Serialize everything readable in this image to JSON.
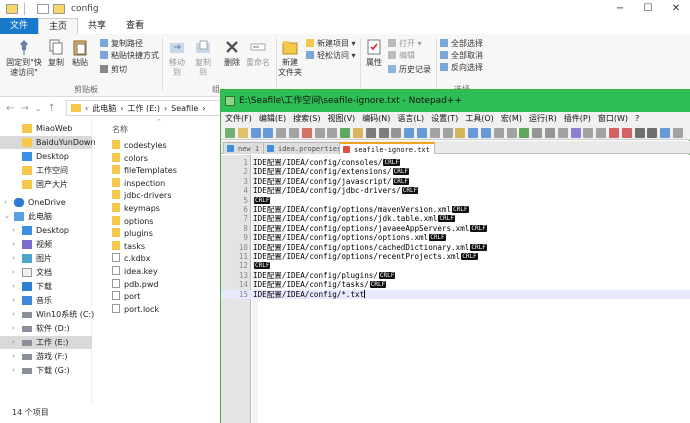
{
  "explorer": {
    "window_title": "config",
    "ribbon_tabs": [
      "文件",
      "主页",
      "共享",
      "查看"
    ],
    "ribbon": {
      "pin_label": "固定到\"快速访问\"",
      "copy_label": "复制",
      "paste_label": "粘贴",
      "copy_path": "复制路径",
      "paste_shortcut": "粘贴快捷方式",
      "cut": "剪切",
      "clipboard_group": "剪贴板",
      "move_to": "移动到",
      "copy_to": "复制到",
      "delete": "删除",
      "rename": "重命名",
      "organize_group": "组",
      "new_folder": "新建\n文件夹",
      "new_item": "新建项目",
      "easy_access": "轻松访问",
      "properties": "属性",
      "open": "打开",
      "edit": "编辑",
      "history": "历史记录",
      "select_all": "全部选择",
      "select_none": "全部取消",
      "invert_selection": "反向选择",
      "select_group": "选择"
    },
    "breadcrumb": [
      "此电脑",
      "工作 (E:)",
      "Seafile"
    ],
    "nav_items": [
      {
        "label": "MiaoWeb",
        "icon": "folder-icon",
        "indent": 1
      },
      {
        "label": "BaiduYunDown",
        "icon": "folder-icon",
        "indent": 1,
        "selected": true
      },
      {
        "label": "Desktop",
        "icon": "desktop-icon",
        "indent": 1
      },
      {
        "label": "工作空间",
        "icon": "folder-icon",
        "indent": 1
      },
      {
        "label": "国产大片",
        "icon": "folder-icon",
        "indent": 1
      },
      {
        "label": "OneDrive",
        "icon": "cloud-icon",
        "indent": 0,
        "arrow": "›"
      },
      {
        "label": "此电脑",
        "icon": "computer-icon",
        "indent": 0,
        "arrow": "⌄"
      },
      {
        "label": "Desktop",
        "icon": "desktop-icon",
        "indent": 1,
        "arrow": "›"
      },
      {
        "label": "视频",
        "icon": "video-icon",
        "indent": 1,
        "arrow": "›"
      },
      {
        "label": "图片",
        "icon": "picture-icon",
        "indent": 1,
        "arrow": "›"
      },
      {
        "label": "文档",
        "icon": "document-icon",
        "indent": 1,
        "arrow": "›"
      },
      {
        "label": "下载",
        "icon": "download-icon",
        "indent": 1,
        "arrow": "›"
      },
      {
        "label": "音乐",
        "icon": "music-icon",
        "indent": 1,
        "arrow": "›"
      },
      {
        "label": "Win10系统 (C:)",
        "icon": "drive-icon",
        "indent": 1,
        "arrow": "›"
      },
      {
        "label": "软件 (D:)",
        "icon": "drive-icon",
        "indent": 1,
        "arrow": "›"
      },
      {
        "label": "工作 (E:)",
        "icon": "drive-icon",
        "indent": 1,
        "arrow": "›",
        "selected": true
      },
      {
        "label": "游戏 (F:)",
        "icon": "drive-icon",
        "indent": 1,
        "arrow": "›"
      },
      {
        "label": "下载 (G:)",
        "icon": "drive-icon",
        "indent": 1,
        "arrow": "›"
      }
    ],
    "column_header": "名称",
    "files": [
      {
        "name": "codestyles",
        "type": "folder"
      },
      {
        "name": "colors",
        "type": "folder"
      },
      {
        "name": "fileTemplates",
        "type": "folder"
      },
      {
        "name": "inspection",
        "type": "folder"
      },
      {
        "name": "jdbc-drivers",
        "type": "folder"
      },
      {
        "name": "keymaps",
        "type": "folder"
      },
      {
        "name": "options",
        "type": "folder"
      },
      {
        "name": "plugins",
        "type": "folder"
      },
      {
        "name": "tasks",
        "type": "folder"
      },
      {
        "name": "c.kdbx",
        "type": "file"
      },
      {
        "name": "idea.key",
        "type": "file"
      },
      {
        "name": "pdb.pwd",
        "type": "file"
      },
      {
        "name": "port",
        "type": "file"
      },
      {
        "name": "port.lock",
        "type": "file"
      }
    ],
    "status": "14 个项目"
  },
  "notepad": {
    "title": "E:\\Seafile\\工作空间\\seafile-ignore.txt - Notepad++",
    "menu": [
      "文件(F)",
      "编辑(E)",
      "搜索(S)",
      "视图(V)",
      "编码(N)",
      "语言(L)",
      "设置(T)",
      "工具(O)",
      "宏(M)",
      "运行(R)",
      "插件(P)",
      "窗口(W)",
      "?"
    ],
    "tabs": [
      {
        "label": "new 1",
        "active": false
      },
      {
        "label": "idea.properties",
        "active": false
      },
      {
        "label": "seafile-ignore.txt",
        "active": true
      }
    ],
    "eol_marker": "CRLF",
    "current_line": 15,
    "lines": [
      {
        "n": "1",
        "text": "IDE配置/IDEA/config/consoles/",
        "eol": true
      },
      {
        "n": "2",
        "text": "IDE配置/IDEA/config/extensions/",
        "eol": true
      },
      {
        "n": "3",
        "text": "IDE配置/IDEA/config/javascript/",
        "eol": true
      },
      {
        "n": "4",
        "text": "IDE配置/IDEA/config/jdbc-drivers/",
        "eol": true
      },
      {
        "n": "5",
        "text": "",
        "eol": true
      },
      {
        "n": "6",
        "text": "IDE配置/IDEA/config/options/mavenVersion.xml",
        "eol": true
      },
      {
        "n": "7",
        "text": "IDE配置/IDEA/config/options/jdk.table.xml",
        "eol": true
      },
      {
        "n": "8",
        "text": "IDE配置/IDEA/config/options/javaeeAppServers.xml",
        "eol": true
      },
      {
        "n": "9",
        "text": "IDE配置/IDEA/config/options/options.xml",
        "eol": true
      },
      {
        "n": "10",
        "text": "IDE配置/IDEA/config/options/cachedDictionary.xml",
        "eol": true
      },
      {
        "n": "11",
        "text": "IDE配置/IDEA/config/options/recentProjects.xml",
        "eol": true
      },
      {
        "n": "12",
        "text": "",
        "eol": true
      },
      {
        "n": "13",
        "text": "IDE配置/IDEA/config/plugins/",
        "eol": true
      },
      {
        "n": "14",
        "text": "IDE配置/IDEA/config/tasks/",
        "eol": true
      },
      {
        "n": "15",
        "text": "IDE配置/IDEA/config/*.txt",
        "eol": false
      }
    ]
  },
  "colors": {
    "file_tab": "#1979ca",
    "npp_title": "#2dbf56",
    "folder": "#f5c84c"
  }
}
